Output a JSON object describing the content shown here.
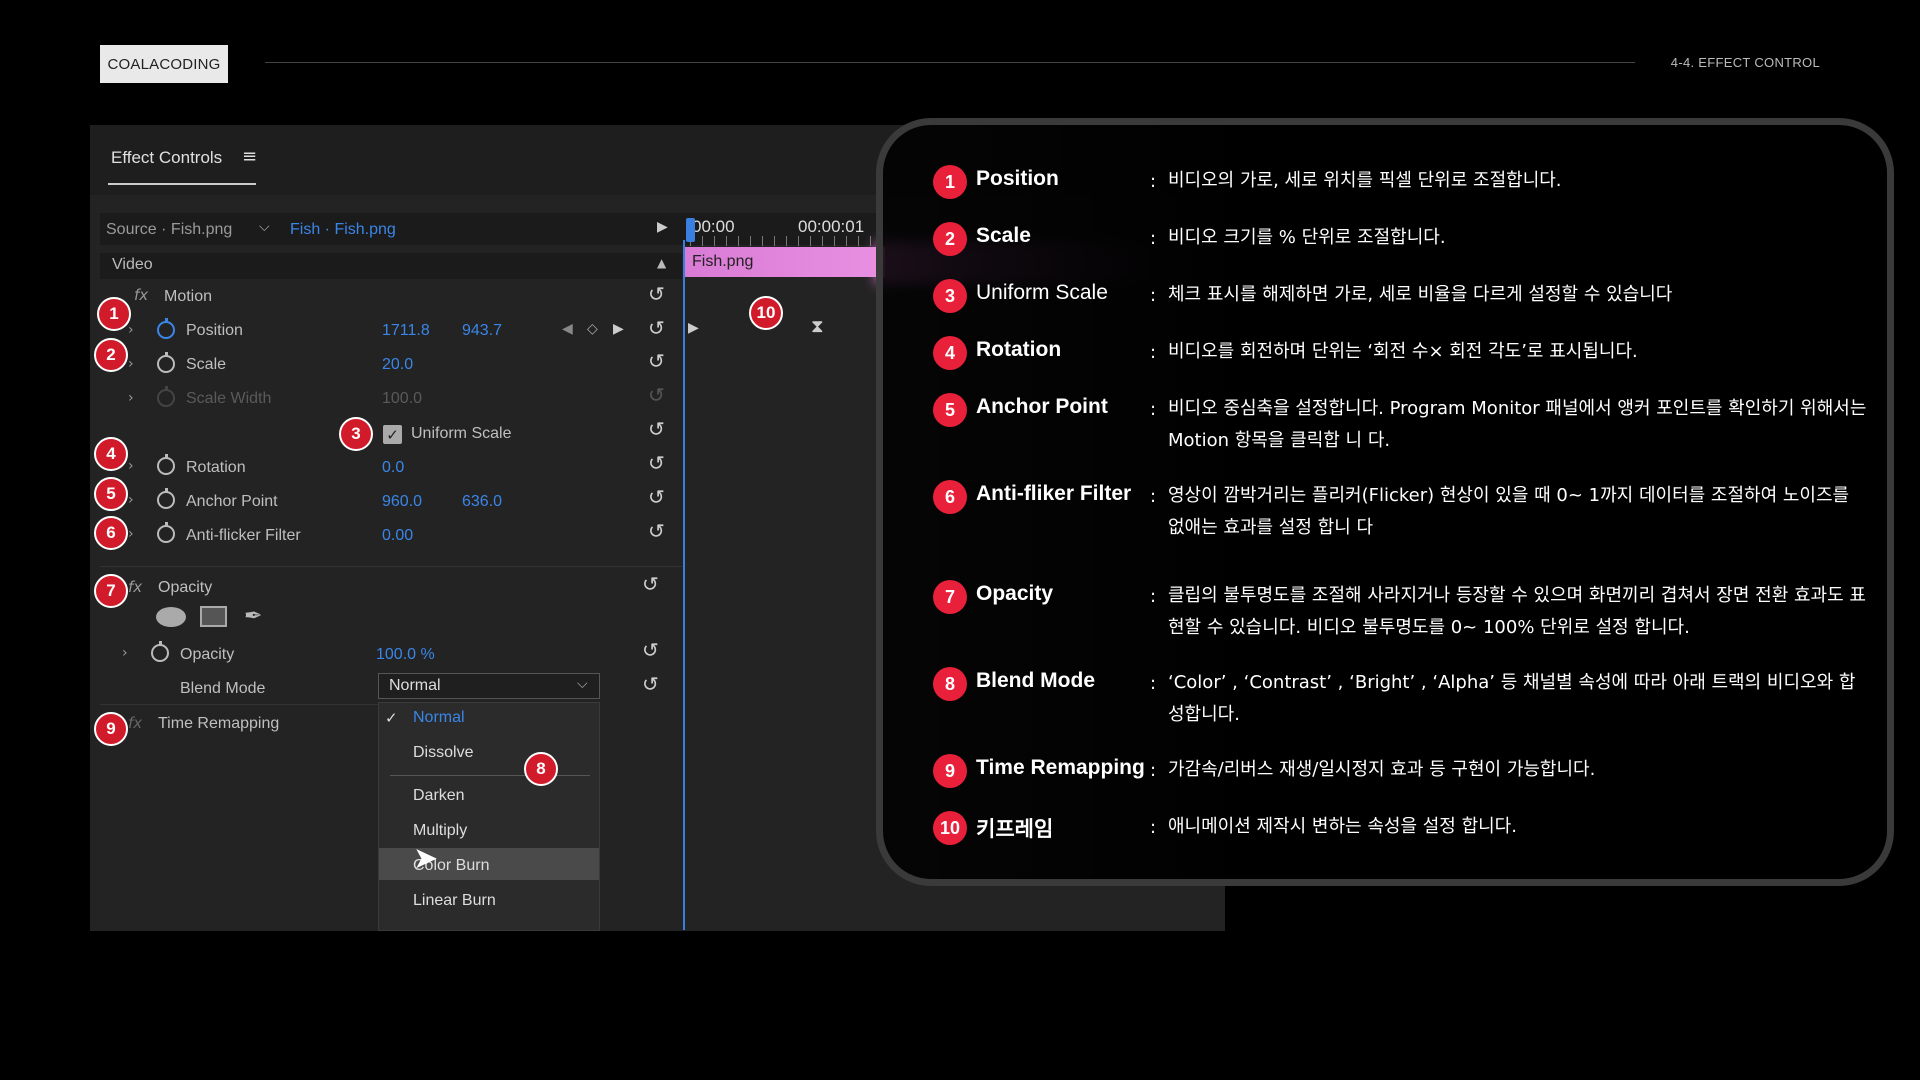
{
  "header": {
    "brand": "COALACODING",
    "section": "4-4. EFFECT CONTROL"
  },
  "panel": {
    "tab_title": "Effect Controls",
    "source_label": "Source · Fish.png",
    "clip_label": "Fish · Fish.png",
    "timecodes": [
      "00:00",
      "00:00:01"
    ],
    "video_label": "Video",
    "timeline_clip": "Fish.png",
    "motion": {
      "label": "Motion",
      "position": {
        "label": "Position",
        "x": "1711.8",
        "y": "943.7"
      },
      "scale": {
        "label": "Scale",
        "value": "20.0"
      },
      "scale_width": {
        "label": "Scale Width",
        "value": "100.0"
      },
      "uniform_scale": {
        "label": "Uniform Scale",
        "checked": true
      },
      "rotation": {
        "label": "Rotation",
        "value": "0.0"
      },
      "anchor_point": {
        "label": "Anchor Point",
        "x": "960.0",
        "y": "636.0"
      },
      "anti_flicker": {
        "label": "Anti-flicker Filter",
        "value": "0.00"
      }
    },
    "opacity": {
      "label": "Opacity",
      "opacity_row": {
        "label": "Opacity",
        "value": "100.0 %"
      },
      "blend_mode": {
        "label": "Blend Mode",
        "value": "Normal"
      }
    },
    "time_remapping": {
      "label": "Time Remapping"
    },
    "blend_options": [
      "Normal",
      "Dissolve",
      "Darken",
      "Multiply",
      "Color Burn",
      "Linear Burn"
    ],
    "selected_option": "Normal",
    "hovered_option": "Color Burn"
  },
  "callouts": [
    "1",
    "2",
    "3",
    "4",
    "5",
    "6",
    "7",
    "8",
    "9",
    "10"
  ],
  "info": [
    {
      "num": "1",
      "name": "Position",
      "desc": "비디오의 가로, 세로 위치를 픽셀 단위로 조절합니다."
    },
    {
      "num": "2",
      "name": "Scale",
      "desc": "비디오 크기를 % 단위로 조절합니다."
    },
    {
      "num": "3",
      "name": "Uniform Scale",
      "desc": "체크 표시를 해제하면 가로, 세로 비율을 다르게 설정할 수 있습니다"
    },
    {
      "num": "4",
      "name": "Rotation",
      "desc": "비디오를 회전하며 단위는 ‘회전 수× 회전 각도’로 표시됩니다."
    },
    {
      "num": "5",
      "name": "Anchor Point",
      "desc": "비디오 중심축을 설정합니다. Program Monitor 패널에서 앵커 포인트를 확인하기 위해서는 Motion 항목을 클릭합 니 다."
    },
    {
      "num": "6",
      "name": "Anti-fliker Filter",
      "desc": "영상이 깜박거리는 플리커(Flicker) 현상이 있을 때 0~ 1까지 데이터를 조절하여 노이즈를 없애는 효과를 설정 합니 다"
    },
    {
      "num": "7",
      "name": "Opacity",
      "desc": "클립의 불투명도를 조절해 사라지거나 등장할 수 있으며 화면끼리 겹쳐서 장면 전환 효과도 표현할 수 있습니다. 비디오 불투명도를 0~ 100% 단위로 설정 합니다."
    },
    {
      "num": "8",
      "name": "Blend Mode",
      "desc": "‘Color’ , ‘Contrast’ , ‘Bright’ , ‘Alpha’  등 채널별 속성에 따라 아래 트랙의 비디오와 합성합니다."
    },
    {
      "num": "9",
      "name": "Time Remapping",
      "desc": "가감속/리버스 재생/일시정지 효과 등 구현이 가능합니다."
    },
    {
      "num": "10",
      "name": "키프레임",
      "desc": "애니메이션 제작시 변하는 속성을 설정 합니다."
    }
  ],
  "colors": {
    "accent": "#3a86e8",
    "badge": "#d21b2a",
    "clip": "#e38ade",
    "info_badge": "#e8203a"
  },
  "icons": [
    "stopwatch-icon",
    "reset-icon",
    "chevron-right-icon",
    "fx-icon",
    "checkmark-icon",
    "ellipse-mask-icon",
    "rectangle-mask-icon",
    "pen-mask-icon",
    "keyframe-icon",
    "cursor-icon"
  ]
}
